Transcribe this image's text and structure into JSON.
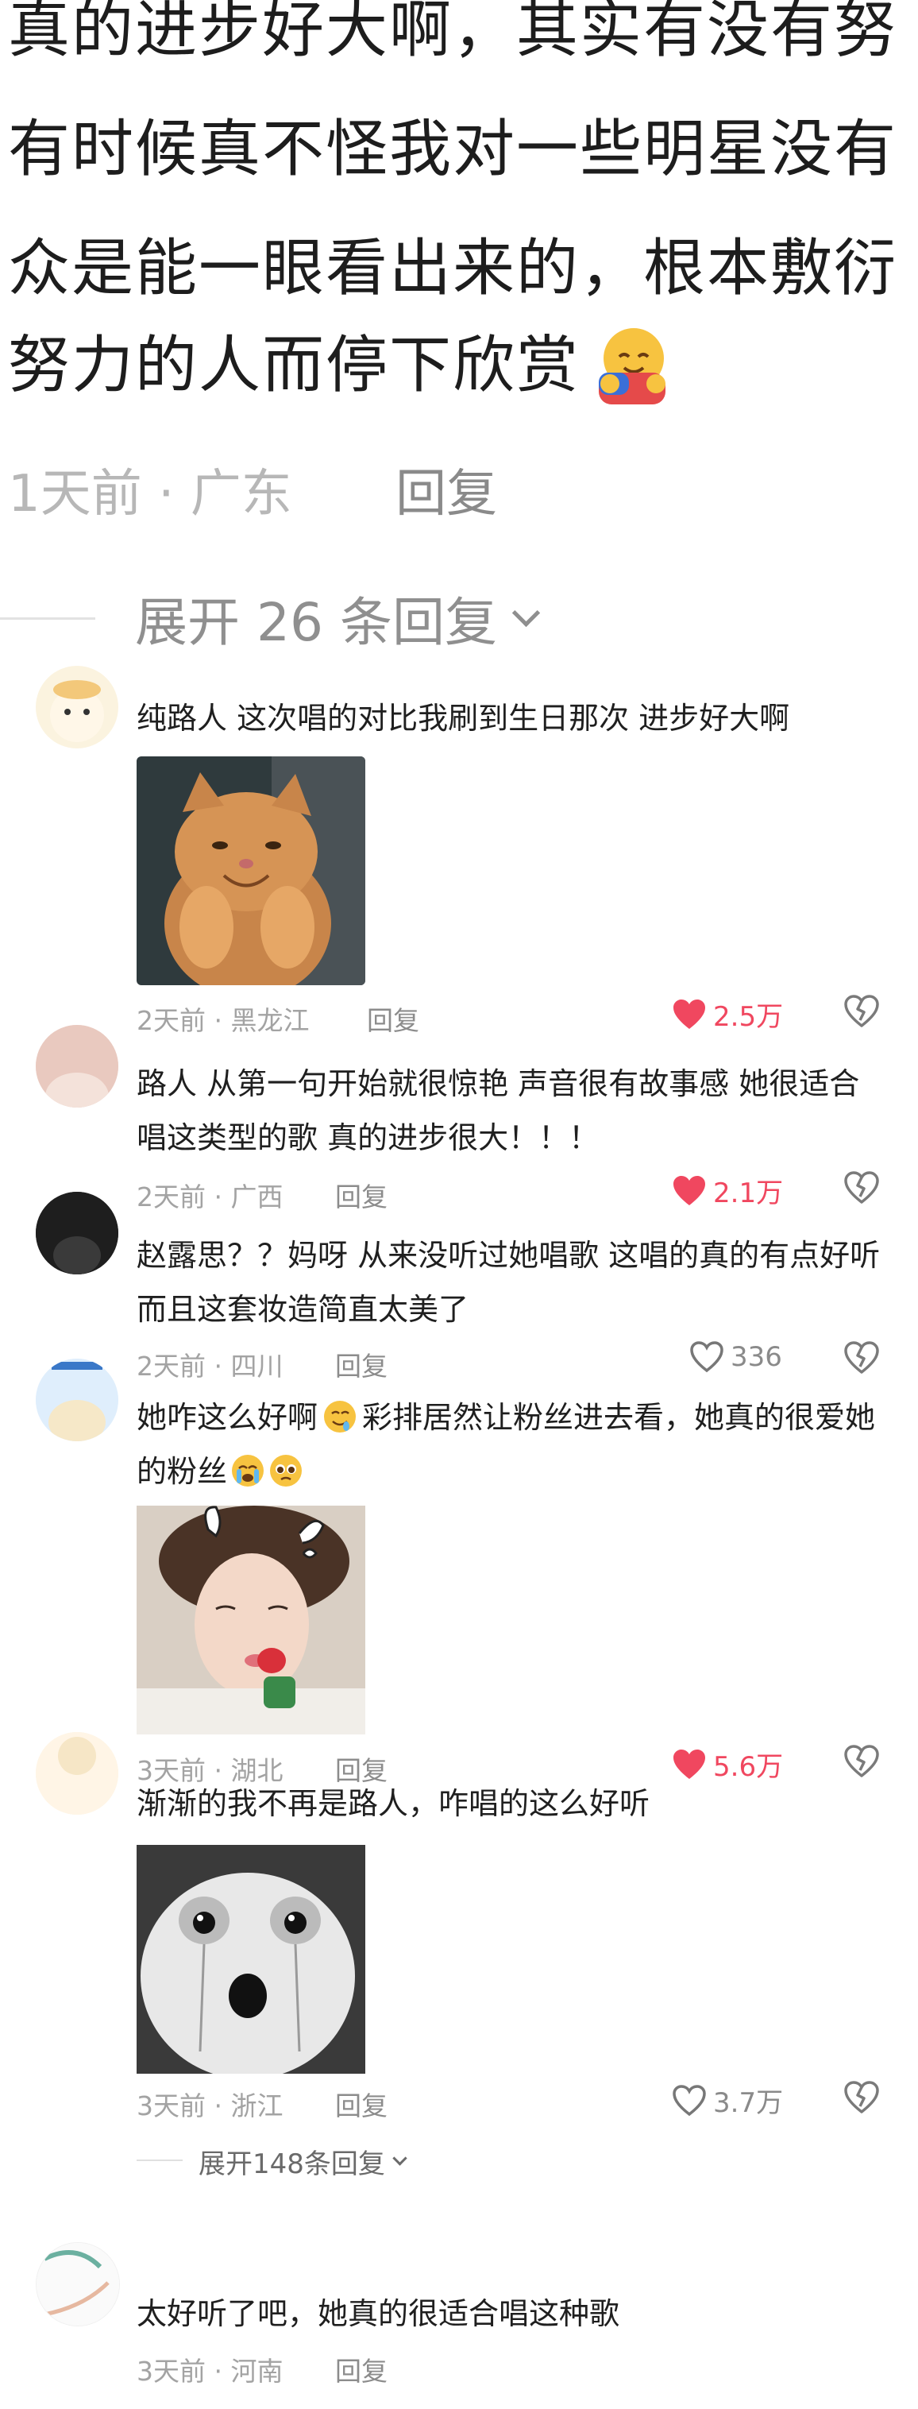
{
  "top_comment": {
    "lines": [
      "真的进步好大啊，其实有没有努",
      "有时候真不怪我对一些明星没有",
      "众是能一眼看出来的，根本敷衍",
      "努力的人而停下欣赏"
    ],
    "emoji_icon": "hugging-face-icon",
    "time": "1天前",
    "location": "广东",
    "reply_label": "回复",
    "expand_label": "展开 26 条回复"
  },
  "comments": [
    {
      "text": "纯路人 这次唱的对比我刷到生日那次 进步好大啊",
      "time": "2天前",
      "location": "黑龙江",
      "reply": "回复",
      "likes": "2.5万",
      "liked": true,
      "has_image": true,
      "image_icon": "smiling-cat-photo"
    },
    {
      "text": "路人 从第一句开始就很惊艳 声音很有故事感 她很适合唱这类型的歌 真的进步很大！！！",
      "time": "2天前",
      "location": "广西",
      "reply": "回复",
      "likes": "2.1万",
      "liked": true
    },
    {
      "text": "赵露思？？妈呀 从来没听过她唱歌 这唱的真的有点好听 而且这套妆造简直太美了",
      "time": "2天前",
      "location": "四川",
      "reply": "回复",
      "likes": "336",
      "liked": false
    },
    {
      "text": "她咋这么好啊",
      "text_tail": "彩排居然让粉丝进去看，她真的很爱她的粉丝",
      "emoji_1": "drooling-face-icon",
      "emoji_2": "crying-face-icon",
      "emoji_3": "pleading-face-icon",
      "time": "3天前",
      "location": "湖北",
      "reply": "回复",
      "likes": "5.6万",
      "liked": true,
      "has_image": true,
      "image_icon": "woman-eating-strawberry-photo"
    },
    {
      "text": "渐渐的我不再是路人，咋唱的这么好听",
      "time": "3天前",
      "location": "浙江",
      "reply": "回复",
      "likes": "3.7万",
      "liked": false,
      "has_image": true,
      "image_icon": "crying-plush-face-photo"
    }
  ],
  "expand_small": "展开148条回复",
  "last_comment": {
    "text": "太好听了吧，她真的很适合唱这种歌",
    "time": "3天前",
    "location": "河南",
    "reply": "回复"
  },
  "colors": {
    "like_red": "#f0475f",
    "meta_gray": "#a3a3a3"
  }
}
